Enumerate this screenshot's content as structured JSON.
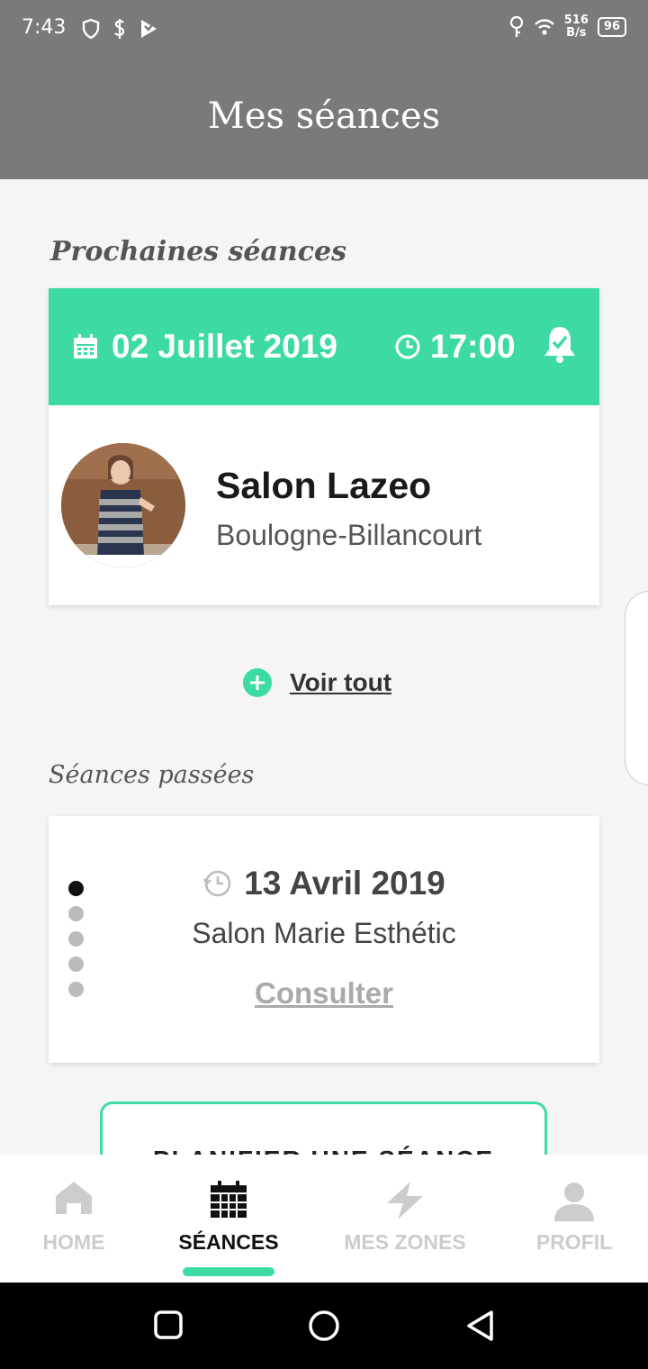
{
  "status_bar": {
    "time": "7:43",
    "speed_value": "516",
    "speed_unit": "B/s",
    "battery": "96"
  },
  "header": {
    "title": "Mes séances"
  },
  "upcoming": {
    "section_title": "Prochaines séances",
    "date": "02 Juillet 2019",
    "time": "17:00",
    "salon_name": "Salon Lazeo",
    "city": "Boulogne-Billancourt",
    "see_all_label": "Voir tout"
  },
  "past": {
    "section_title": "Séances passées",
    "date": "13 Avril 2019",
    "salon_name": "Salon Marie Esthétic",
    "consult_label": "Consulter",
    "carousel_count": 5,
    "carousel_active_index": 0
  },
  "plan_button": {
    "label": "PLANIFIER UNE SÉANCE"
  },
  "bottom_nav": {
    "items": [
      {
        "label": "HOME",
        "icon": "home-icon"
      },
      {
        "label": "SÉANCES",
        "icon": "calendar-grid-icon"
      },
      {
        "label": "MES ZONES",
        "icon": "lightning-icon"
      },
      {
        "label": "PROFIL",
        "icon": "user-icon"
      }
    ],
    "active_index": 1
  },
  "colors": {
    "accent": "#3ddba1",
    "header_bg": "#7a7a7a",
    "page_bg": "#f5f5f5"
  }
}
